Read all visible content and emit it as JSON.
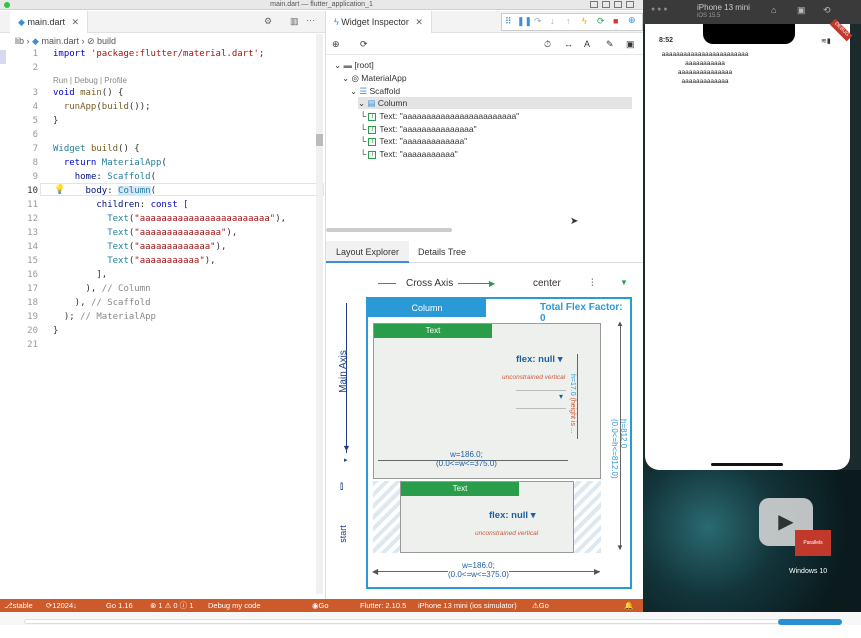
{
  "window": {
    "title": "main.dart — flutter_application_1"
  },
  "editor": {
    "tab": "main.dart",
    "breadcrumb": {
      "lib": "lib",
      "file": "main.dart",
      "symbol": "build"
    },
    "codelens": "Run | Debug | Profile",
    "lines": [
      {
        "n": "1",
        "text": "import 'package:flutter/material.dart';"
      },
      {
        "n": "2",
        "text": ""
      },
      {
        "n": "3",
        "text": "void main() {"
      },
      {
        "n": "4",
        "text": "  runApp(build());"
      },
      {
        "n": "5",
        "text": "}"
      },
      {
        "n": "6",
        "text": ""
      },
      {
        "n": "7",
        "text": "Widget build() {"
      },
      {
        "n": "8",
        "text": "  return MaterialApp("
      },
      {
        "n": "9",
        "text": "    home: Scaffold("
      },
      {
        "n": "10",
        "text": "      body: Column("
      },
      {
        "n": "11",
        "text": "        children: const ["
      },
      {
        "n": "12",
        "text": "          Text(\"aaaaaaaaaaaaaaaaaaaaaaaa\"),"
      },
      {
        "n": "13",
        "text": "          Text(\"aaaaaaaaaaaaaaa\"),"
      },
      {
        "n": "14",
        "text": "          Text(\"aaaaaaaaaaaaa\"),"
      },
      {
        "n": "15",
        "text": "          Text(\"aaaaaaaaaaa\"),"
      },
      {
        "n": "16",
        "text": "        ],"
      },
      {
        "n": "17",
        "text": "      ), // Column"
      },
      {
        "n": "18",
        "text": "    ), // Scaffold"
      },
      {
        "n": "19",
        "text": "  ); // MaterialApp"
      },
      {
        "n": "20",
        "text": "}"
      },
      {
        "n": "21",
        "text": ""
      }
    ]
  },
  "status": {
    "branch": "stable",
    "sync": "12024↓ 10↑",
    "go": "Go 1.16",
    "problems": "⊗ 1 ⚠ 0 ⓘ 1",
    "debug": "Debug my code",
    "golive": "Go Live",
    "flutter": "Flutter: 2.10.5",
    "device": "iPhone 13 mini (ios simulator)",
    "update": "Go Update Available"
  },
  "inspector": {
    "tab": "Widget Inspector",
    "tree": {
      "root": "[root]",
      "app": "MaterialApp",
      "scaffold": "Scaffold",
      "column": "Column",
      "texts": [
        "Text: \"aaaaaaaaaaaaaaaaaaaaaaaa\"",
        "Text: \"aaaaaaaaaaaaaaa\"",
        "Text: \"aaaaaaaaaaaaa\"",
        "Text: \"aaaaaaaaaaa\""
      ]
    },
    "tabs": {
      "layout": "Layout Explorer",
      "details": "Details Tree"
    },
    "layout": {
      "cross_axis": "Cross Axis",
      "cross_value": "center",
      "main_axis": "Main Axis",
      "main_value": "start",
      "column_label": "Column",
      "flex_factor": "Total Flex Factor: 0",
      "child1": "Text",
      "child2": "Text",
      "flex1": "flex: null",
      "flex2": "flex: null",
      "unconstrained": "unconstrained vertical",
      "h_child": "h=17.0",
      "h_child_sub": "(height is ...",
      "w_child": "w=186.0;",
      "w_child_sub": "(0.0<=w<=375.0)",
      "h_outer": "h=812.0",
      "h_outer_sub": "(0.0<=h<=812.0)",
      "w_outer": "w=186.0;",
      "w_outer_sub": "(0.0<=w<=375.0)"
    }
  },
  "simulator": {
    "title": "iPhone 13 mini",
    "subtitle": "iOS 15.5",
    "time": "8:52",
    "lines": [
      "aaaaaaaaaaaaaaaaaaaaaaaa",
      "aaaaaaaaaaaaaaa",
      "aaaaaaaaaaaaa",
      "aaaaaaaaaaa"
    ],
    "debug_badge": "DEBUG",
    "dock_label": "Windows 10",
    "parallels": "Parallels"
  }
}
